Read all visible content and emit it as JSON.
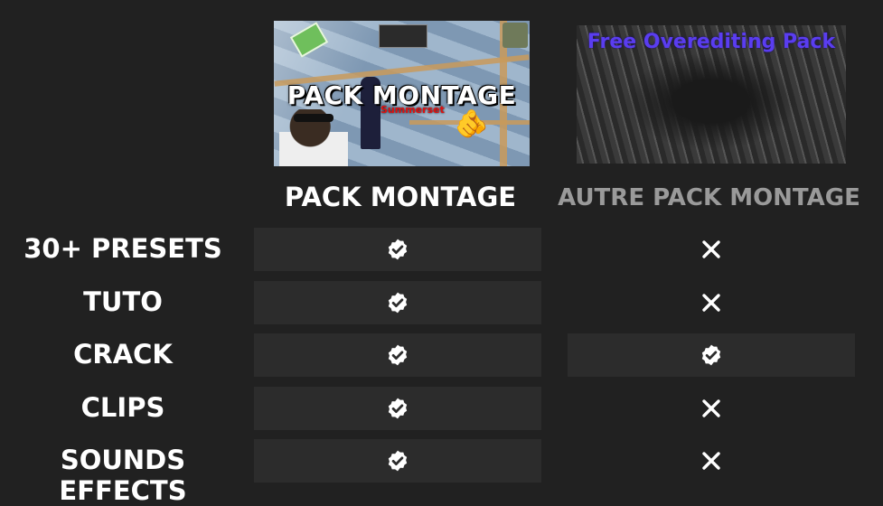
{
  "thumbnails": {
    "left": {
      "title": "PACK MONTAGE",
      "subtitle": "Summerset"
    },
    "right": {
      "title": "Free Overediting Pack"
    }
  },
  "columns": {
    "left": "PACK MONTAGE",
    "right": "AUTRE PACK MONTAGE"
  },
  "rows": [
    {
      "label": "30+ PRESETS",
      "left": "check-icon",
      "right": "cross-icon"
    },
    {
      "label": "TUTO",
      "left": "check-icon",
      "right": "cross-icon"
    },
    {
      "label": "CRACK",
      "left": "check-icon",
      "right": "check-icon"
    },
    {
      "label": "CLIPS",
      "left": "check-icon",
      "right": "cross-icon"
    },
    {
      "label": "SOUNDS EFFECTS",
      "left": "check-icon",
      "right": "cross-icon"
    }
  ],
  "colors": {
    "background": "#212121",
    "cell": "#2c2c2c",
    "header_active": "#ffffff",
    "header_muted": "#9a9a9a",
    "accent_purple": "#5a3df0"
  }
}
